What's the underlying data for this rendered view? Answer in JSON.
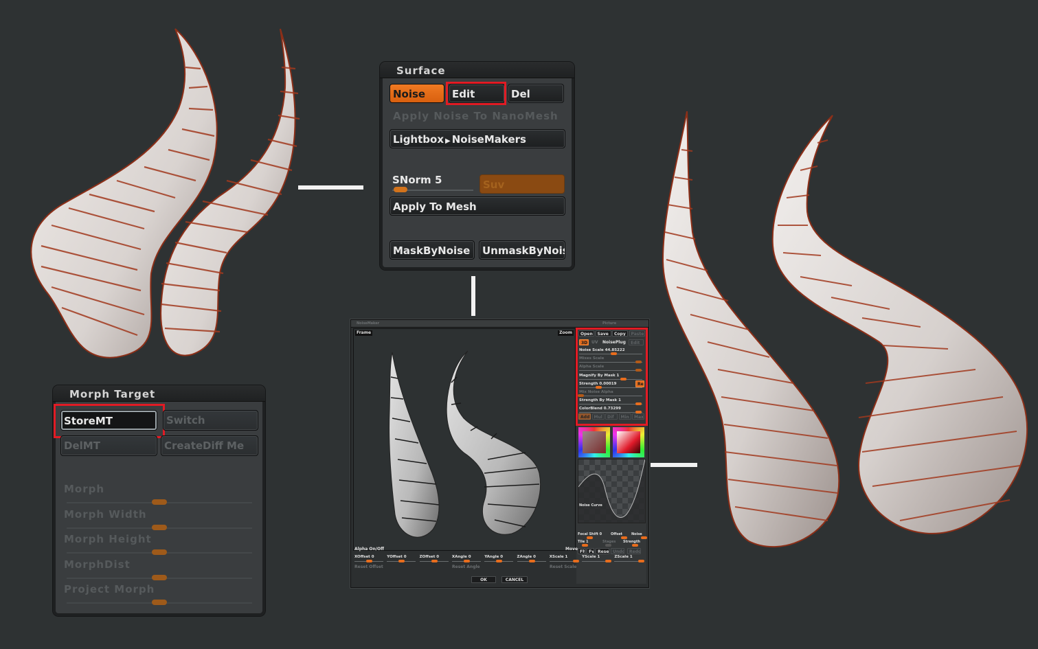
{
  "colors": {
    "background": "#2e3233",
    "accent_orange": "#e86d1d",
    "highlight_red": "#e21b24",
    "horn_base": "#e6e2e0",
    "horn_crease": "#a23a1f"
  },
  "images": {
    "left_render": {
      "label": "horns-before-noise",
      "icon": "horn-render"
    },
    "right_render": {
      "label": "horns-after-noise",
      "icon": "horn-render"
    },
    "preview_render": {
      "label": "noise-preview-horns",
      "icon": "horn-render"
    }
  },
  "surface_palette": {
    "title": "Surface",
    "buttons": {
      "noise": "Noise",
      "edit": "Edit",
      "del": "Del",
      "apply_nanomesh": "Apply Noise To NanoMesh",
      "lightbox": "Lightbox",
      "lightbox_arrow": "▶",
      "noisemakers": "NoiseMakers",
      "suv": "Suv",
      "apply_mesh": "Apply To Mesh",
      "mask_by_noise": "MaskByNoise",
      "unmask_by_noise": "UnmaskByNois"
    },
    "snorm": {
      "label": "SNorm",
      "value": "5",
      "fraction": 0.05
    },
    "highlighted": "Edit"
  },
  "morph_palette": {
    "title": "Morph Target",
    "buttons": {
      "store": "StoreMT",
      "switch": "Switch",
      "del": "DelMT",
      "create_diff": "CreateDiff Me"
    },
    "highlighted": "StoreMT",
    "sliders": [
      {
        "label": "Morph",
        "fraction": 0.5
      },
      {
        "label": "Morph Width",
        "fraction": 0.5
      },
      {
        "label": "Morph Height",
        "fraction": 0.5
      },
      {
        "label": "MorphDist",
        "fraction": 0.5
      },
      {
        "label": "Project Morph",
        "fraction": 0.5
      }
    ]
  },
  "noisemaker": {
    "title": "NoiseMaker",
    "frame_label": "Frame",
    "zoom_label": "Zoom",
    "picture_label": "Picture",
    "top_buttons": [
      "Open",
      "Save",
      "Copy",
      "Paste"
    ],
    "mode_buttons": {
      "3d": "3D",
      "uv": "UV",
      "noise_plug": "NoisePlug",
      "edit": "Edit"
    },
    "params": [
      {
        "label": "Noise Scale",
        "value": "44.85222",
        "fraction": 0.55,
        "dim": false
      },
      {
        "label": "Mixes Scale",
        "value": "",
        "fraction": 0.95,
        "dim": true
      },
      {
        "label": "Alpha Scale",
        "value": "",
        "fraction": 0.95,
        "dim": true
      },
      {
        "label": "Magnify By Mask",
        "value": "1",
        "fraction": 0.7,
        "dim": false
      },
      {
        "label": "Strength",
        "value": "0.00019",
        "fraction": 0.3,
        "dim": false
      },
      {
        "label": "Mix Noise Alpha",
        "value": "",
        "fraction": 0.0,
        "dim": true
      },
      {
        "label": "Strength By Mask",
        "value": "1",
        "fraction": 0.95,
        "dim": false
      },
      {
        "label": "ColorBlend",
        "value": "0.73299",
        "fraction": 0.95,
        "dim": false
      }
    ],
    "rel_button": "Rel",
    "blend_modes": [
      "Add",
      "Mul",
      "Dif",
      "Min",
      "Max"
    ],
    "noise_curve_label": "Noise Curve",
    "curve_params": [
      {
        "label": "Focal Shift",
        "value": "0",
        "fraction": 0.5
      },
      {
        "label": "Offset",
        "value": "",
        "fraction": 0.6
      },
      {
        "label": "Noise",
        "value": "",
        "fraction": 0.55
      },
      {
        "label": "Tile",
        "value": "1",
        "fraction": 0.1
      },
      {
        "label": "Stages",
        "value": "",
        "fraction": 0.0
      },
      {
        "label": "Strength",
        "value": "",
        "fraction": 0.5
      }
    ],
    "curve_buttons": [
      "Fh",
      "Fv",
      "Reset",
      "Undo",
      "Redo"
    ],
    "alpha_toggle": "Alpha On/Off",
    "move_label": "Move",
    "transform": [
      {
        "label": "XOffset",
        "value": "0",
        "fraction": 0.5
      },
      {
        "label": "YOffset",
        "value": "0",
        "fraction": 0.5
      },
      {
        "label": "ZOffset",
        "value": "0",
        "fraction": 0.5
      },
      {
        "label": "XAngle",
        "value": "0",
        "fraction": 0.5
      },
      {
        "label": "YAngle",
        "value": "0",
        "fraction": 0.5
      },
      {
        "label": "ZAngle",
        "value": "0",
        "fraction": 0.5
      },
      {
        "label": "XScale",
        "value": "1",
        "fraction": 0.95
      },
      {
        "label": "YScale",
        "value": "1",
        "fraction": 0.95
      },
      {
        "label": "ZScale",
        "value": "1",
        "fraction": 0.95
      }
    ],
    "reset_offset": "Reset Offset",
    "reset_angle": "Reset Angle",
    "reset_scale": "Reset Scale",
    "ok": "OK",
    "cancel": "CANCEL"
  }
}
